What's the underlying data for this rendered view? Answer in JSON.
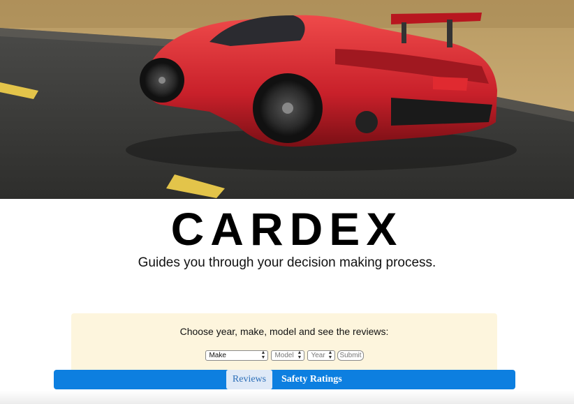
{
  "hero": {
    "image": "red-sports-car-on-road"
  },
  "site": {
    "title": "CARDEX",
    "tagline": "Guides you through your decision making process."
  },
  "search": {
    "prompt": "Choose year, make, model and see the reviews:",
    "make_value": "Make",
    "model_value": "Model",
    "year_value": "Year",
    "submit_label": "Submit"
  },
  "nav": {
    "tabs": [
      {
        "label": "Reviews",
        "active": true
      },
      {
        "label": "Safety Ratings",
        "active": false
      }
    ]
  },
  "colors": {
    "nav_bg": "#0d7fe0",
    "panel_bg": "#fdf5dd",
    "car": "#d6242c"
  }
}
